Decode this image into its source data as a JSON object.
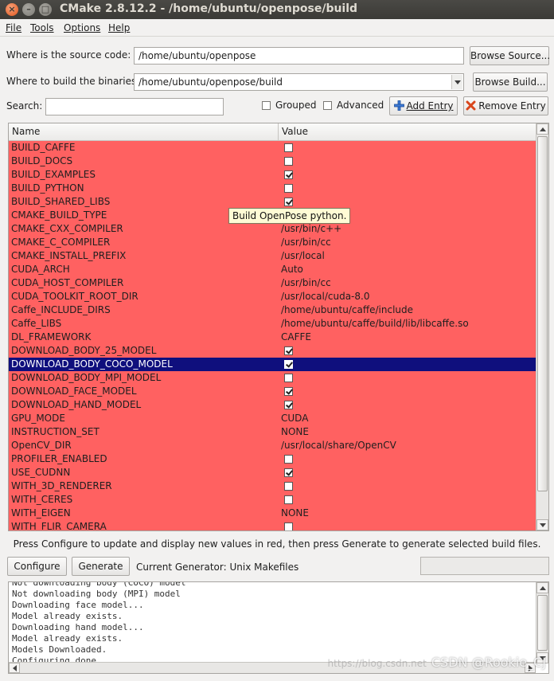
{
  "window": {
    "title": "CMake 2.8.12.2 - /home/ubuntu/openpose/build"
  },
  "menu": [
    {
      "label": "File"
    },
    {
      "label": "Tools"
    },
    {
      "label": "Options"
    },
    {
      "label": "Help"
    }
  ],
  "source": {
    "label": "Where is the source code:",
    "value": "/home/ubuntu/openpose",
    "browse_label": "Browse Source..."
  },
  "build": {
    "label": "Where to build the binaries:",
    "value": "/home/ubuntu/openpose/build",
    "browse_label": "Browse Build..."
  },
  "search": {
    "label": "Search:",
    "value": "",
    "grouped_label": "Grouped",
    "grouped_checked": false,
    "advanced_label": "Advanced",
    "advanced_checked": false,
    "add_entry_label": "Add Entry",
    "remove_entry_label": "Remove Entry"
  },
  "table": {
    "headers": {
      "name": "Name",
      "value": "Value"
    },
    "highlight_color": "#ff6161",
    "selected_color": "#0f0f7d",
    "rows": [
      {
        "name": "BUILD_CAFFE",
        "kind": "bool",
        "checked": false
      },
      {
        "name": "BUILD_DOCS",
        "kind": "bool",
        "checked": false
      },
      {
        "name": "BUILD_EXAMPLES",
        "kind": "bool",
        "checked": true
      },
      {
        "name": "BUILD_PYTHON",
        "kind": "bool",
        "checked": false
      },
      {
        "name": "BUILD_SHARED_LIBS",
        "kind": "bool",
        "checked": true
      },
      {
        "name": "CMAKE_BUILD_TYPE",
        "kind": "text",
        "value": ""
      },
      {
        "name": "CMAKE_CXX_COMPILER",
        "kind": "text",
        "value": "/usr/bin/c++"
      },
      {
        "name": "CMAKE_C_COMPILER",
        "kind": "text",
        "value": "/usr/bin/cc"
      },
      {
        "name": "CMAKE_INSTALL_PREFIX",
        "kind": "text",
        "value": "/usr/local"
      },
      {
        "name": "CUDA_ARCH",
        "kind": "text",
        "value": "Auto"
      },
      {
        "name": "CUDA_HOST_COMPILER",
        "kind": "text",
        "value": "/usr/bin/cc"
      },
      {
        "name": "CUDA_TOOLKIT_ROOT_DIR",
        "kind": "text",
        "value": "/usr/local/cuda-8.0"
      },
      {
        "name": "Caffe_INCLUDE_DIRS",
        "kind": "text",
        "value": "/home/ubuntu/caffe/include"
      },
      {
        "name": "Caffe_LIBS",
        "kind": "text",
        "value": "/home/ubuntu/caffe/build/lib/libcaffe.so"
      },
      {
        "name": "DL_FRAMEWORK",
        "kind": "text",
        "value": "CAFFE"
      },
      {
        "name": "DOWNLOAD_BODY_25_MODEL",
        "kind": "bool",
        "checked": true
      },
      {
        "name": "DOWNLOAD_BODY_COCO_MODEL",
        "kind": "bool",
        "checked": true,
        "selected": true
      },
      {
        "name": "DOWNLOAD_BODY_MPI_MODEL",
        "kind": "bool",
        "checked": false
      },
      {
        "name": "DOWNLOAD_FACE_MODEL",
        "kind": "bool",
        "checked": true
      },
      {
        "name": "DOWNLOAD_HAND_MODEL",
        "kind": "bool",
        "checked": true
      },
      {
        "name": "GPU_MODE",
        "kind": "text",
        "value": "CUDA"
      },
      {
        "name": "INSTRUCTION_SET",
        "kind": "text",
        "value": "NONE"
      },
      {
        "name": "OpenCV_DIR",
        "kind": "text",
        "value": "/usr/local/share/OpenCV"
      },
      {
        "name": "PROFILER_ENABLED",
        "kind": "bool",
        "checked": false
      },
      {
        "name": "USE_CUDNN",
        "kind": "bool",
        "checked": true
      },
      {
        "name": "WITH_3D_RENDERER",
        "kind": "bool",
        "checked": false
      },
      {
        "name": "WITH_CERES",
        "kind": "bool",
        "checked": false
      },
      {
        "name": "WITH_EIGEN",
        "kind": "text",
        "value": "NONE"
      },
      {
        "name": "WITH_FLIR_CAMERA",
        "kind": "bool",
        "checked": false
      }
    ]
  },
  "tooltip": {
    "text": "Build OpenPose python."
  },
  "hint": "Press Configure to update and display new values in red, then press Generate to generate selected build files.",
  "actions": {
    "configure_label": "Configure",
    "generate_label": "Generate",
    "generator_text": "Current Generator: Unix Makefiles"
  },
  "output": {
    "lines": [
      "Not downloading body (COCO) model",
      "Not downloading body (MPI) model",
      "Downloading face model...",
      "Model already exists.",
      "Downloading hand model...",
      "Model already exists.",
      "Models Downloaded.",
      "Configuring done"
    ]
  },
  "watermark": {
    "faint": "https://blog.csdn.net",
    "text": "CSDN @Rookie_CJ"
  }
}
